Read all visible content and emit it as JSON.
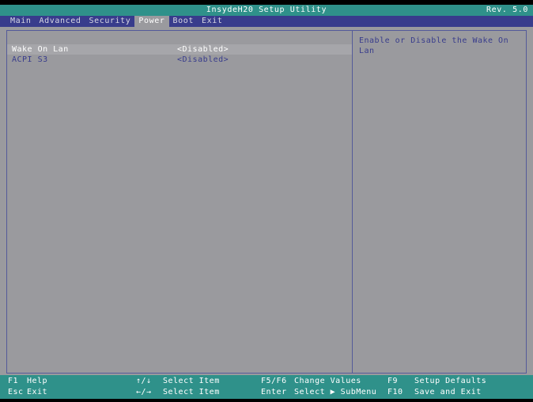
{
  "titlebar": {
    "title": "InsydeH20 Setup Utility",
    "revision": "Rev. 5.0"
  },
  "menubar": {
    "items": [
      {
        "label": "Main",
        "active": false
      },
      {
        "label": "Advanced",
        "active": false
      },
      {
        "label": "Security",
        "active": false
      },
      {
        "label": "Power",
        "active": true
      },
      {
        "label": "Boot",
        "active": false
      },
      {
        "label": "Exit",
        "active": false
      }
    ]
  },
  "settings": {
    "rows": [
      {
        "label": "Wake On Lan",
        "value": "<Disabled>",
        "selected": true
      },
      {
        "label": "ACPI S3",
        "value": "<Disabled>",
        "selected": false
      }
    ]
  },
  "help": {
    "text": "Enable or Disable the Wake On Lan"
  },
  "footer": {
    "keys": [
      {
        "key": "F1",
        "desc": "Help"
      },
      {
        "key": "Esc",
        "desc": "Exit"
      },
      {
        "key": "↑/↓",
        "desc": "Select Item"
      },
      {
        "key": "←/→",
        "desc": "Select Item"
      },
      {
        "key": "F5/F6",
        "desc": "Change Values"
      },
      {
        "key": "Enter",
        "desc": "Select ▶ SubMenu"
      },
      {
        "key": "F9",
        "desc": "Setup Defaults"
      },
      {
        "key": "F10",
        "desc": "Save and Exit"
      }
    ]
  },
  "colors": {
    "titlebar_bg": "#2f918a",
    "menubar_bg": "#383c8c",
    "panel_bg": "#9a9a9e",
    "border": "#545a9a",
    "text_blue": "#383c8c",
    "text_white": "#ffffff",
    "footer_bg": "#2f918a"
  }
}
